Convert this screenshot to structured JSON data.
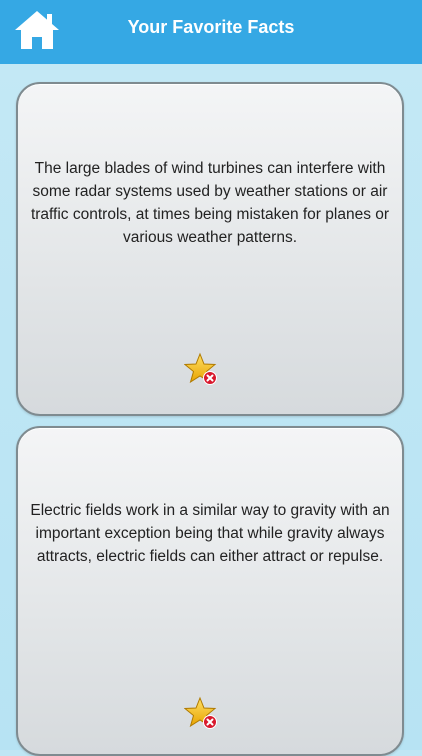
{
  "header": {
    "title": "Your Favorite Facts",
    "home_icon": "home-icon"
  },
  "facts": [
    {
      "text": "The large blades of wind turbines can interfere with some radar systems used by weather stations or air traffic controls, at times being mistaken for planes or various weather patterns.",
      "action_icon": "star-remove-icon"
    },
    {
      "text": "Electric fields work in a similar way to gravity with an important exception being that while gravity always attracts, electric fields can either attract or repulse.",
      "action_icon": "star-remove-icon"
    }
  ],
  "colors": {
    "header_bg": "#35a8e4",
    "page_bg": "#bfe6f4",
    "card_bg": "#e6e9eb",
    "card_border": "#7f8b90",
    "star": "#f5b800",
    "remove_badge": "#d8182c"
  }
}
